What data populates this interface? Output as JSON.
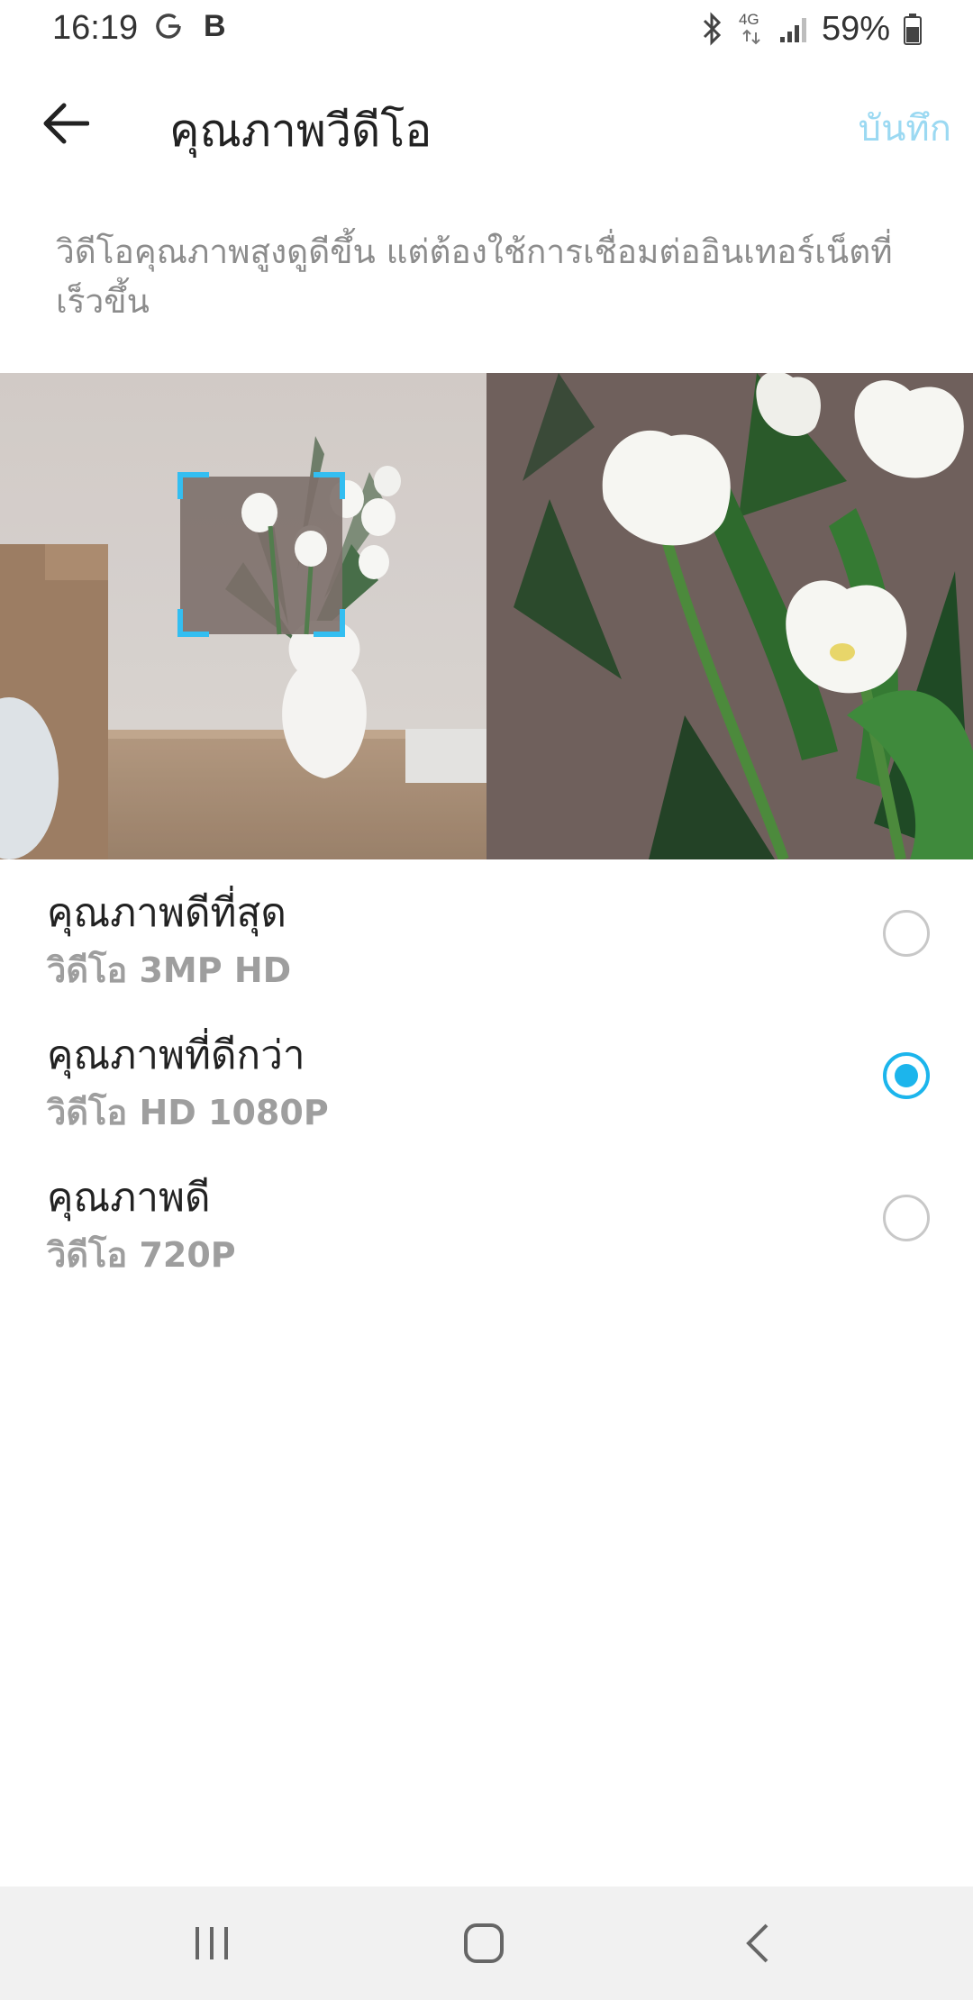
{
  "status_bar": {
    "time": "16:19",
    "b_label": "B",
    "network_label": "4G",
    "battery": "59%",
    "icons": [
      "google-g-icon",
      "bluetooth-icon",
      "network-4g-icon",
      "signal-icon",
      "battery-icon"
    ]
  },
  "app_bar": {
    "title": "คุณภาพวีดีโอ",
    "save_label": "บันทึก"
  },
  "description": "วิดีโอคุณภาพสูงดูดีขึ้น แต่ต้องใช้การเชื่อมต่ออินเทอร์เน็ตที่เร็วขึ้น",
  "options": [
    {
      "title": "คุณภาพดีที่สุด",
      "subtitle": "วิดีโอ 3MP HD",
      "selected": false
    },
    {
      "title": "คุณภาพที่ดีกว่า",
      "subtitle": "วิดีโอ HD 1080P",
      "selected": true
    },
    {
      "title": "คุณภาพดี",
      "subtitle": "วิดีโอ 720P",
      "selected": false
    }
  ],
  "colors": {
    "accent": "#1cb5ec",
    "save_disabled": "#9bd9f2",
    "secondary_text": "#9e9e9e",
    "nav_background": "#f1f1f1"
  }
}
